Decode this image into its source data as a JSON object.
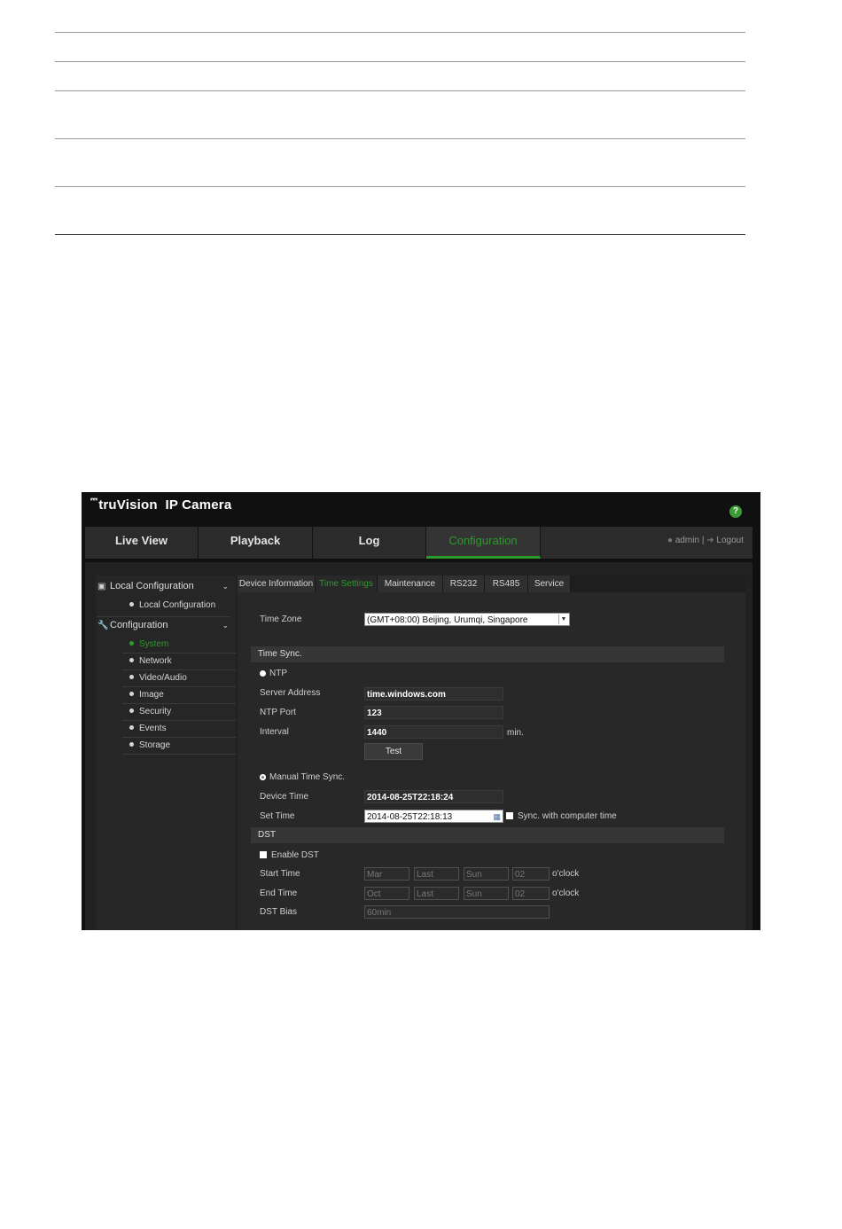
{
  "header": {
    "brand": "truVision",
    "product": "IP Camera",
    "help_icon": "?"
  },
  "nav": {
    "tabs": [
      {
        "label": "Live View"
      },
      {
        "label": "Playback"
      },
      {
        "label": "Log"
      },
      {
        "label": "Configuration",
        "active": true
      }
    ],
    "user": "admin",
    "separator": "|",
    "logout": "Logout"
  },
  "sidebar": {
    "local_header": "Local Configuration",
    "local_items": [
      "Local Configuration"
    ],
    "config_header": "Configuration",
    "config_items": [
      "System",
      "Network",
      "Video/Audio",
      "Image",
      "Security",
      "Events",
      "Storage"
    ],
    "active_item": "System"
  },
  "content_tabs": [
    "Device Information",
    "Time Settings",
    "Maintenance",
    "RS232",
    "RS485",
    "Service"
  ],
  "active_tab": "Time Settings",
  "time_settings": {
    "time_zone_label": "Time Zone",
    "time_zone_value": "(GMT+08:00) Beijing, Urumqi, Singapore",
    "time_sync_header": "Time Sync.",
    "ntp_label": "NTP",
    "server_address_label": "Server Address",
    "server_address_value": "time.windows.com",
    "ntp_port_label": "NTP Port",
    "ntp_port_value": "123",
    "interval_label": "Interval",
    "interval_value": "1440",
    "interval_unit": "min.",
    "test_button": "Test",
    "manual_label": "Manual Time Sync.",
    "device_time_label": "Device Time",
    "device_time_value": "2014-08-25T22:18:24",
    "set_time_label": "Set Time",
    "set_time_value": "2014-08-25T22:18:13",
    "sync_computer_label": "Sync. with computer time",
    "dst_header": "DST",
    "enable_dst_label": "Enable DST",
    "start_time_label": "Start Time",
    "start_time": [
      "Mar",
      "Last",
      "Sun",
      "02"
    ],
    "end_time_label": "End Time",
    "end_time": [
      "Oct",
      "Last",
      "Sun",
      "02"
    ],
    "oclock": "o'clock",
    "dst_bias_label": "DST Bias",
    "dst_bias_value": "60min"
  },
  "colors": {
    "accent": "#2c9a2c",
    "background": "#212121"
  }
}
